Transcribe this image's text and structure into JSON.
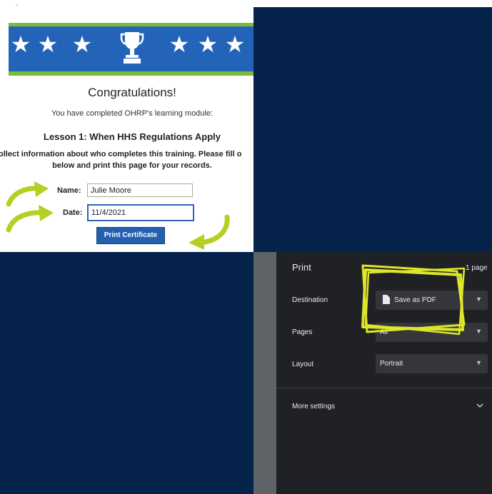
{
  "certificate": {
    "dash": "-",
    "congrats": "Congratulations!",
    "completed": "You have completed OHRP's learning module:",
    "lesson": "Lesson 1: When HHS Regulations Apply",
    "collect_line1": "ollect information about who completes this training. Please fill o",
    "collect_line2": "below and print this page for your records.",
    "name_label": "Name:",
    "name_value": "Julie Moore",
    "date_label": "Date:",
    "date_value": "11/4/2021",
    "print_button": "Print Certificate"
  },
  "print_dialog": {
    "title": "Print",
    "page_count": "1 page",
    "destination_label": "Destination",
    "destination_value": "Save as PDF",
    "pages_label": "Pages",
    "pages_value": "All",
    "layout_label": "Layout",
    "layout_value": "Portrait",
    "more_settings": "More settings"
  },
  "colors": {
    "navy": "#04224a",
    "banner_blue": "#2364b8",
    "banner_green": "#7dbb39",
    "arrow_green": "#b5cf23",
    "highlight_yellow": "#dde62a",
    "dialog_bg": "#202124"
  },
  "icons": {
    "star": "star-icon",
    "trophy": "trophy-icon",
    "document": "document-icon",
    "chevron": "chevron-down-icon",
    "arrow": "curved-arrow-icon"
  }
}
